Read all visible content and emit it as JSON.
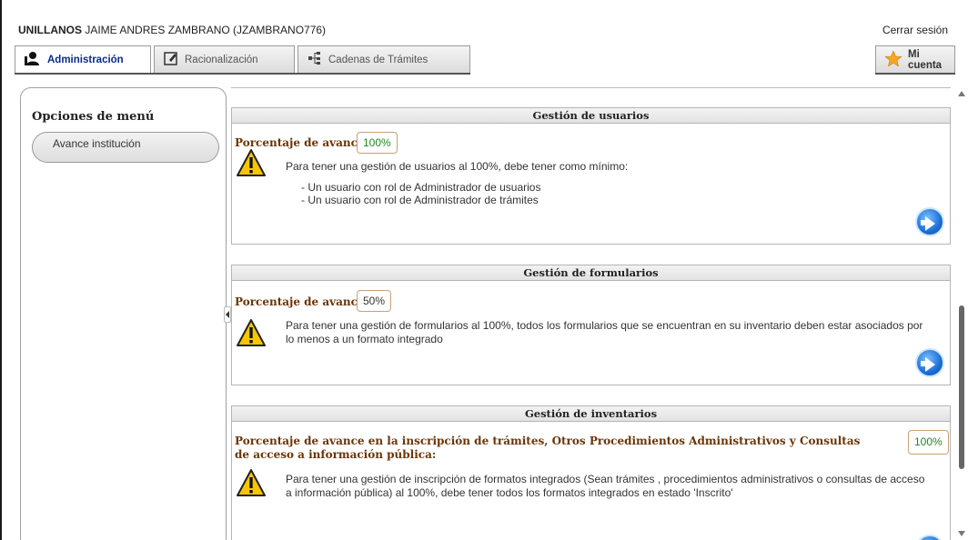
{
  "header": {
    "institution": "UNILLANOS",
    "user": "JAIME ANDRES ZAMBRANO (JZAMBRANO776)",
    "logout": "Cerrar sesión"
  },
  "tabs": [
    {
      "label": "Administración",
      "icon": "admin-user-icon",
      "active": true
    },
    {
      "label": "Racionalización",
      "icon": "edit-icon",
      "active": false
    },
    {
      "label": "Cadenas de Trámites",
      "icon": "hierarchy-icon",
      "active": false
    }
  ],
  "account_tab": {
    "label": "Mi cuenta",
    "icon": "star-icon"
  },
  "sidebar": {
    "title": "Opciones de menú",
    "items": [
      {
        "label": "Avance institución"
      }
    ]
  },
  "sections": [
    {
      "title": "Gestión de usuarios",
      "pct_label": "Porcentaje de avance",
      "pct": "100%",
      "message": "Para tener una gestión de usuarios al 100%, debe tener como mínimo:",
      "bullets": [
        "- Un usuario con rol de Administrador de usuarios",
        "- Un usuario con rol de Administrador de trámites"
      ]
    },
    {
      "title": "Gestión de formularios",
      "pct_label": "Porcentaje de avance",
      "pct": "50%",
      "message": "Para tener una gestión de formularios al 100%, todos los formularios que se encuentran en su inventario deben estar asociados por lo menos a un formato integrado"
    },
    {
      "title": "Gestión de inventarios",
      "pct_label": "Porcentaje de avance en la inscripción de trámites, Otros Procedimientos Administrativos y Consultas de acceso a información pública:",
      "pct": "100%",
      "message": "Para tener una gestión de inscripción de formatos integrados (Sean trámites , procedimientos administrativos o consultas de acceso a información pública) al 100%, debe tener todos los formatos integrados en estado 'Inscrito'"
    }
  ],
  "colors": {
    "accent": "#0a2a8c",
    "pct_ok": "#1f8a1f",
    "pct_label": "#6b3506"
  }
}
